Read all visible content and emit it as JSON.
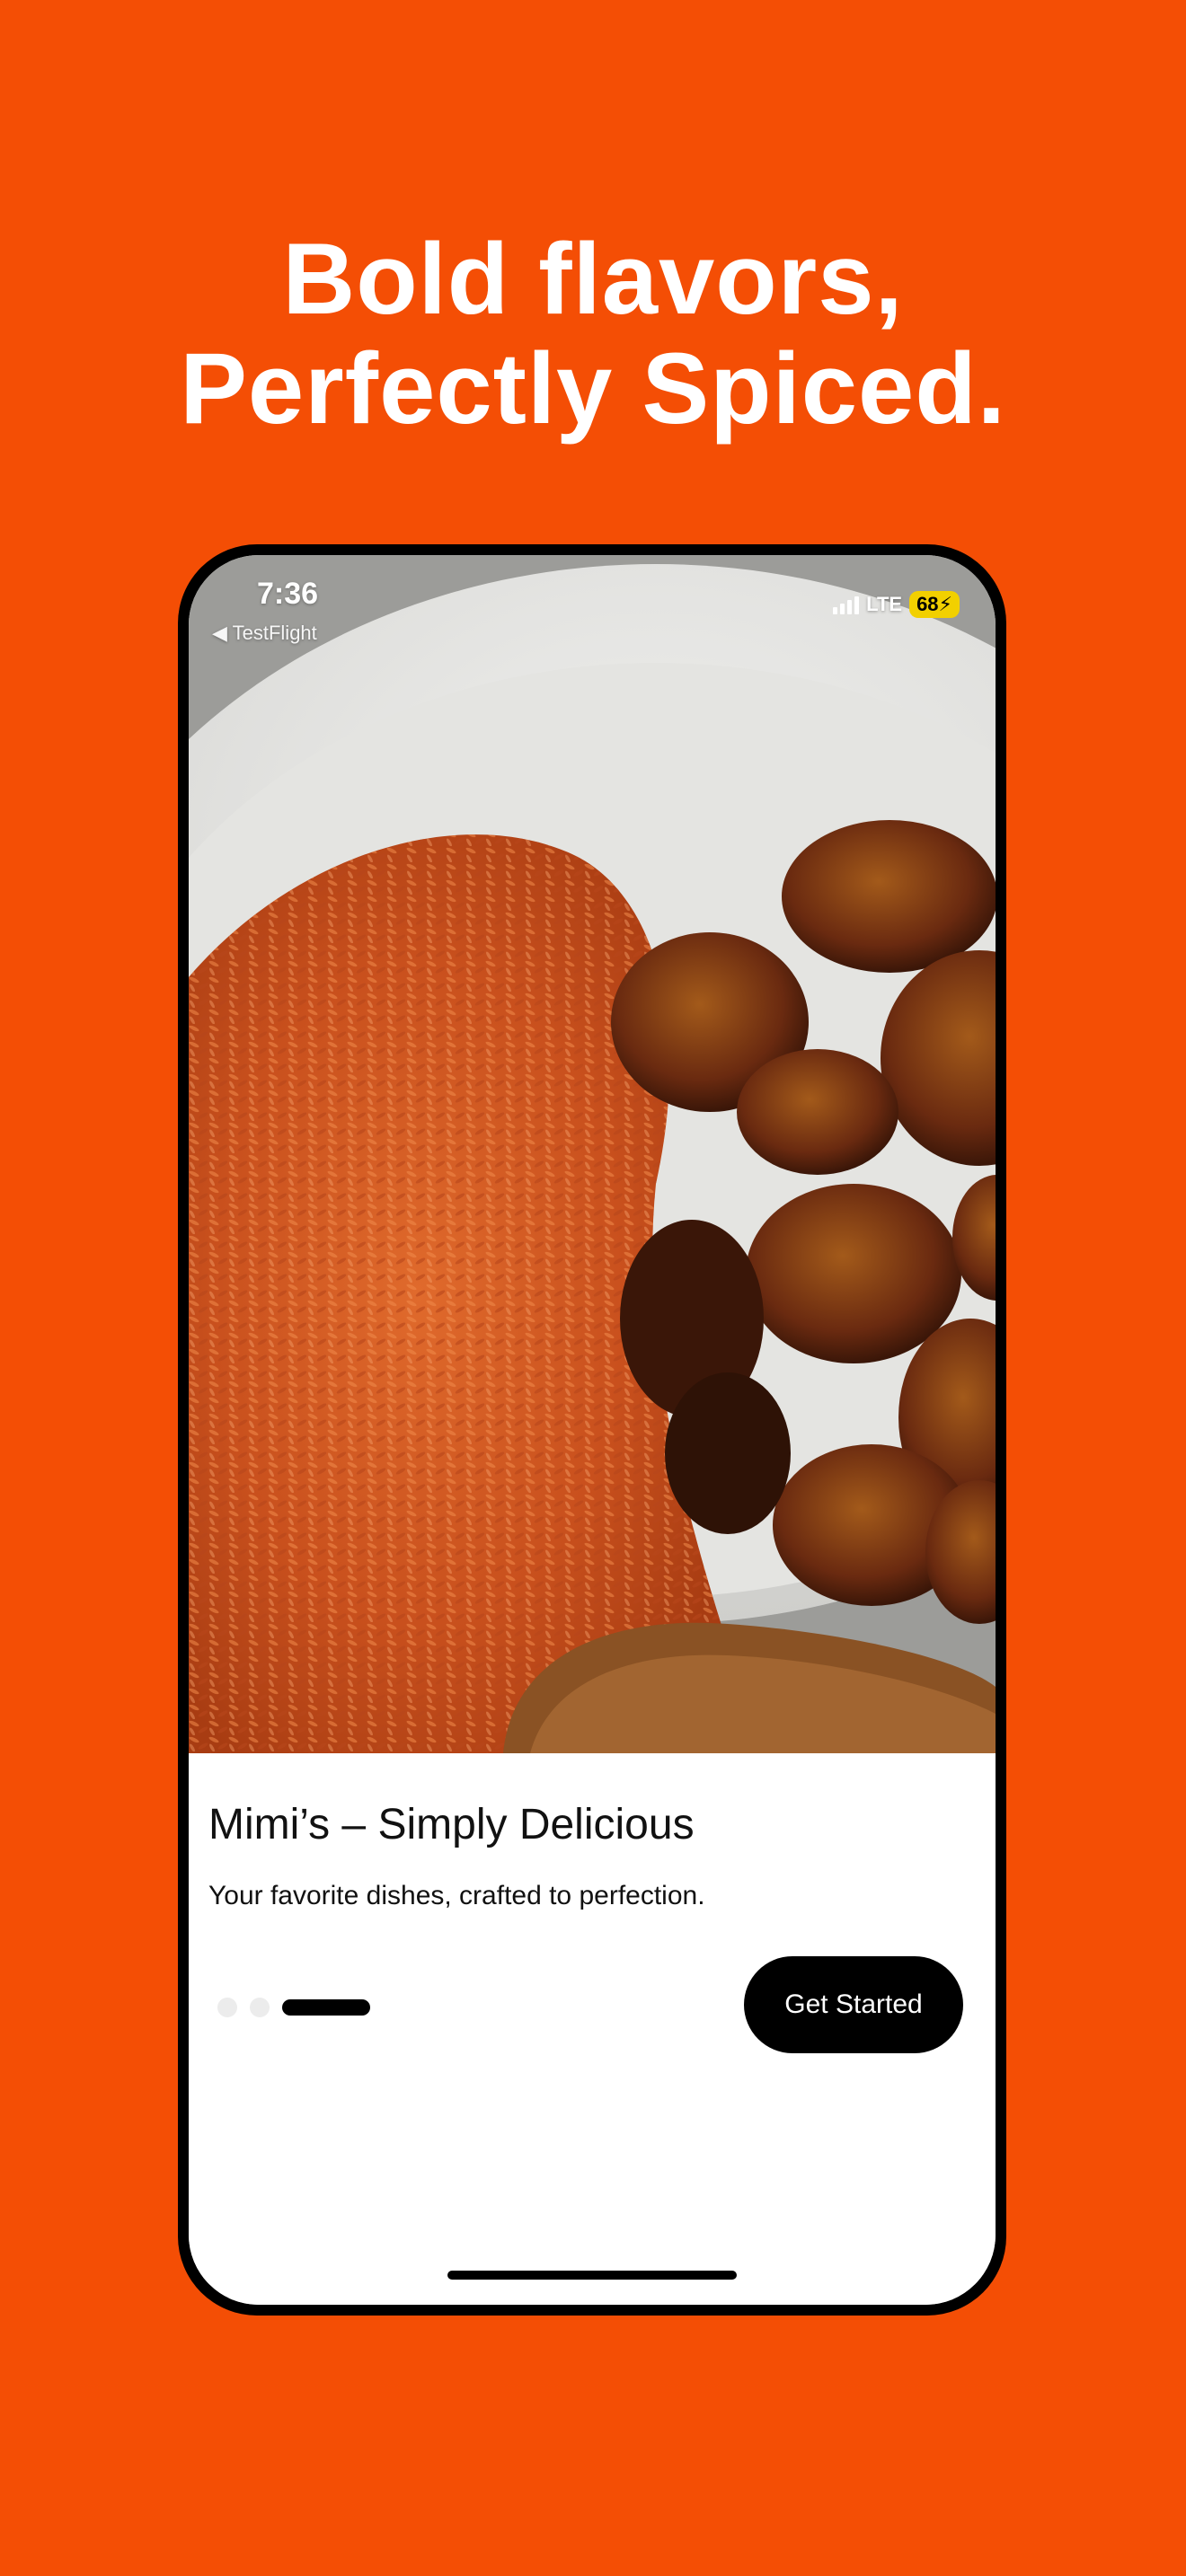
{
  "headline": {
    "line1": "Bold flavors,",
    "line2": "Perfectly Spiced."
  },
  "status_bar": {
    "time": "7:36",
    "back_label": "◀ TestFlight",
    "network": "LTE",
    "battery": "68"
  },
  "onboarding": {
    "title": "Mimi’s – Simply Delicious",
    "subtitle": "Your favorite dishes, crafted to perfection.",
    "cta_label": "Get Started",
    "pages_total": 3,
    "current_page": 3
  },
  "colors": {
    "background": "#f44e05",
    "button": "#000000",
    "battery": "#f2d000"
  },
  "image": {
    "description_icon": "food-photo"
  }
}
